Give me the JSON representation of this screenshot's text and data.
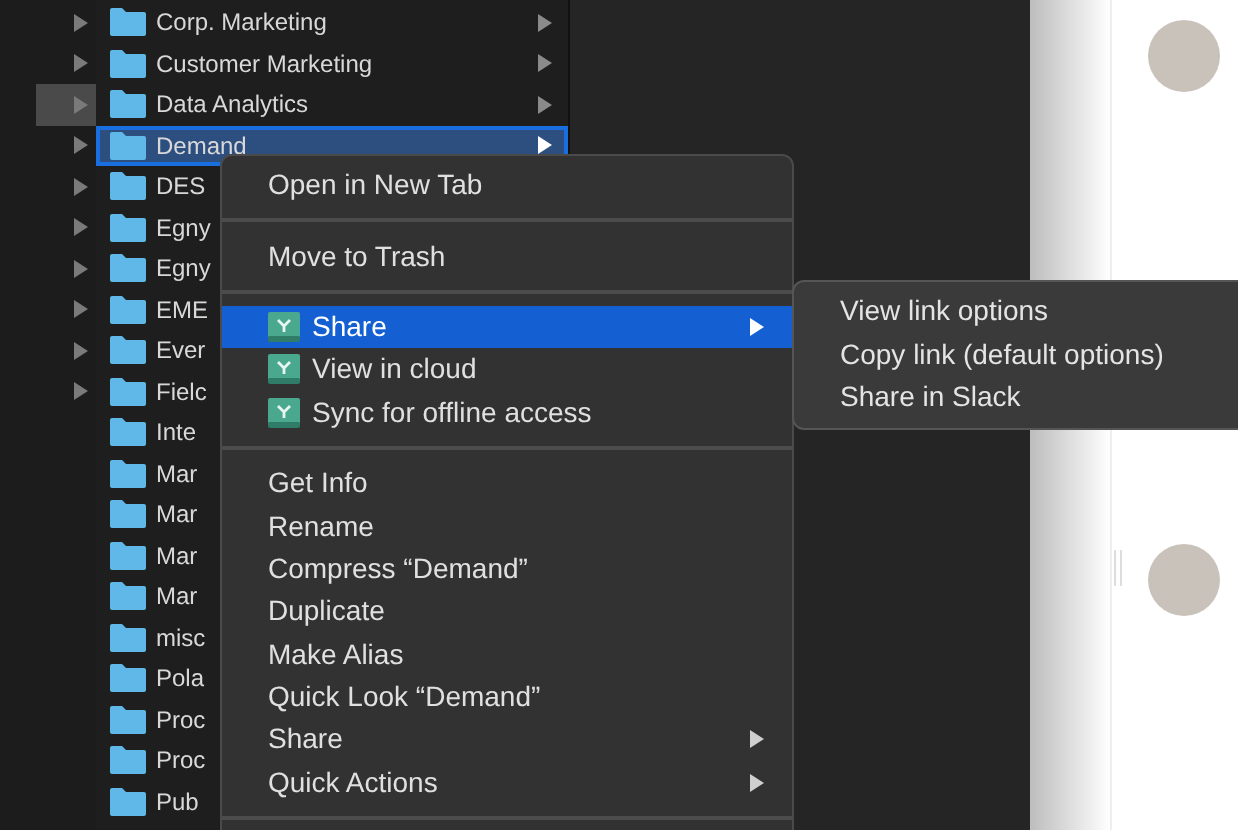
{
  "folders": [
    {
      "name": "Corp. Marketing",
      "left_arrow": true,
      "parent_selected": false,
      "chevron": true,
      "selected": false
    },
    {
      "name": "Customer Marketing",
      "left_arrow": true,
      "parent_selected": false,
      "chevron": true,
      "selected": false
    },
    {
      "name": "Data Analytics",
      "left_arrow": true,
      "parent_selected": true,
      "chevron": true,
      "selected": false
    },
    {
      "name": "Demand",
      "left_arrow": true,
      "parent_selected": false,
      "chevron": true,
      "selected": true
    },
    {
      "name": "DES",
      "left_arrow": true,
      "parent_selected": false,
      "selected": false
    },
    {
      "name": "Egny",
      "left_arrow": true,
      "parent_selected": false,
      "selected": false
    },
    {
      "name": "Egny",
      "left_arrow": true,
      "parent_selected": false,
      "selected": false
    },
    {
      "name": "EME",
      "left_arrow": true,
      "parent_selected": false,
      "selected": false
    },
    {
      "name": "Ever",
      "left_arrow": true,
      "parent_selected": false,
      "selected": false
    },
    {
      "name": "Fielc",
      "left_arrow": true,
      "parent_selected": false,
      "selected": false
    },
    {
      "name": "Inte",
      "left_arrow": false,
      "parent_selected": false,
      "selected": false
    },
    {
      "name": "Mar",
      "left_arrow": false,
      "parent_selected": false,
      "selected": false
    },
    {
      "name": "Mar",
      "left_arrow": false,
      "parent_selected": false,
      "selected": false
    },
    {
      "name": "Mar",
      "left_arrow": false,
      "parent_selected": false,
      "selected": false
    },
    {
      "name": "Mar",
      "left_arrow": false,
      "parent_selected": false,
      "selected": false
    },
    {
      "name": "misc",
      "left_arrow": false,
      "parent_selected": false,
      "selected": false
    },
    {
      "name": "Pola",
      "left_arrow": false,
      "parent_selected": false,
      "selected": false
    },
    {
      "name": "Proc",
      "left_arrow": false,
      "parent_selected": false,
      "selected": false
    },
    {
      "name": "Proc",
      "left_arrow": false,
      "parent_selected": false,
      "selected": false
    },
    {
      "name": "Pub",
      "left_arrow": false,
      "parent_selected": false,
      "selected": false
    }
  ],
  "context_menu": [
    {
      "kind": "item",
      "label": "Open in New Tab",
      "icon": false,
      "submenu": false,
      "selected": false
    },
    {
      "kind": "separator"
    },
    {
      "kind": "item",
      "label": "Move to Trash",
      "icon": false,
      "submenu": false,
      "selected": false
    },
    {
      "kind": "separator"
    },
    {
      "kind": "item",
      "label": "Share",
      "icon": true,
      "submenu": true,
      "selected": true
    },
    {
      "kind": "item",
      "label": "View in cloud",
      "icon": true,
      "submenu": false,
      "selected": false
    },
    {
      "kind": "item",
      "label": "Sync for offline access",
      "icon": true,
      "submenu": false,
      "selected": false
    },
    {
      "kind": "separator"
    },
    {
      "kind": "item",
      "label": "Get Info",
      "icon": false,
      "submenu": false,
      "selected": false
    },
    {
      "kind": "item",
      "label": "Rename",
      "icon": false,
      "submenu": false,
      "selected": false
    },
    {
      "kind": "item",
      "label": "Compress “Demand”",
      "icon": false,
      "submenu": false,
      "selected": false
    },
    {
      "kind": "item",
      "label": "Duplicate",
      "icon": false,
      "submenu": false,
      "selected": false
    },
    {
      "kind": "item",
      "label": "Make Alias",
      "icon": false,
      "submenu": false,
      "selected": false
    },
    {
      "kind": "item",
      "label": "Quick Look “Demand”",
      "icon": false,
      "submenu": false,
      "selected": false
    },
    {
      "kind": "item",
      "label": "Share",
      "icon": false,
      "submenu": true,
      "selected": false
    },
    {
      "kind": "item",
      "label": "Quick Actions",
      "icon": false,
      "submenu": true,
      "selected": false
    },
    {
      "kind": "separator"
    }
  ],
  "submenu": [
    "View link options",
    "Copy link (default options)",
    "Share in Slack"
  ]
}
